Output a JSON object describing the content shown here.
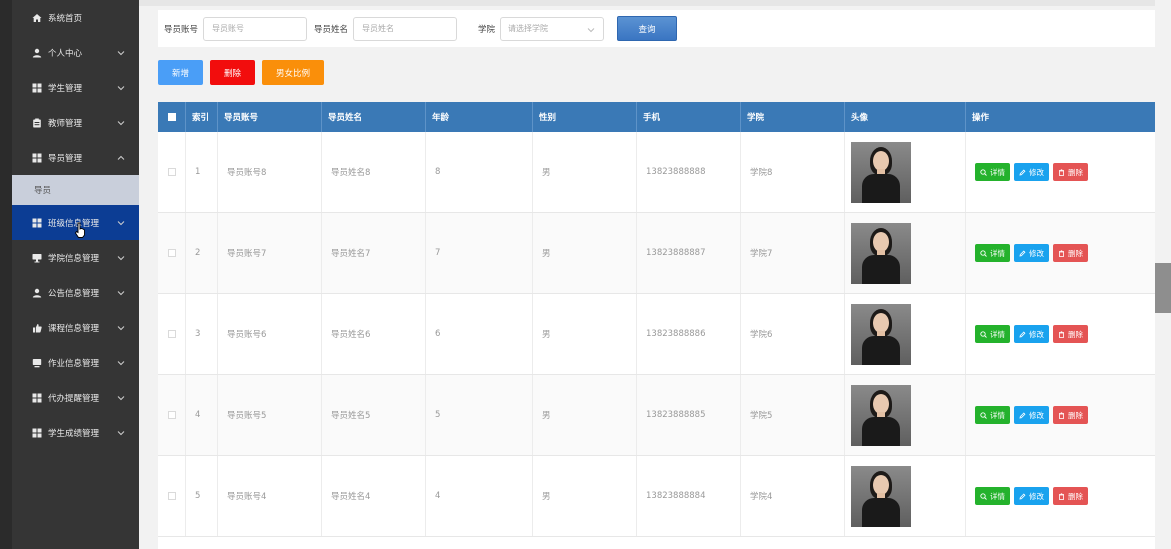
{
  "sidebar": {
    "items": [
      {
        "label": "系统首页",
        "icon": "home-icon",
        "arrow": false
      },
      {
        "label": "个人中心",
        "icon": "user-icon",
        "arrow": "down"
      },
      {
        "label": "学生管理",
        "icon": "grid-icon",
        "arrow": "down"
      },
      {
        "label": "教师管理",
        "icon": "clipboard-icon",
        "arrow": "down"
      },
      {
        "label": "导员管理",
        "icon": "grid-icon",
        "arrow": "up",
        "expanded": true,
        "submenu": [
          "导员"
        ]
      },
      {
        "label": "班级信息管理",
        "icon": "grid-icon",
        "arrow": "down",
        "active": true
      },
      {
        "label": "学院信息管理",
        "icon": "display-icon",
        "arrow": "down"
      },
      {
        "label": "公告信息管理",
        "icon": "user-icon",
        "arrow": "down"
      },
      {
        "label": "课程信息管理",
        "icon": "thumb-icon",
        "arrow": "down"
      },
      {
        "label": "作业信息管理",
        "icon": "monitor-icon",
        "arrow": "down"
      },
      {
        "label": "代办提醒管理",
        "icon": "grid-icon",
        "arrow": "down"
      },
      {
        "label": "学生成绩管理",
        "icon": "grid-icon",
        "arrow": "down"
      }
    ]
  },
  "search": {
    "account_label": "导员账号",
    "account_placeholder": "导员账号",
    "name_label": "导员姓名",
    "name_placeholder": "导员姓名",
    "college_label": "学院",
    "college_placeholder": "请选择学院",
    "query_label": "查询"
  },
  "actions": {
    "add_label": "新增",
    "delete_label": "删除",
    "ratio_label": "男女比例"
  },
  "table": {
    "headers": [
      "索引",
      "导员账号",
      "导员姓名",
      "年龄",
      "性别",
      "手机",
      "学院",
      "头像",
      "操作"
    ],
    "rows": [
      {
        "index": "1",
        "account": "导员账号8",
        "name": "导员姓名8",
        "age": "8",
        "gender": "男",
        "phone": "13823888888",
        "college": "学院8"
      },
      {
        "index": "2",
        "account": "导员账号7",
        "name": "导员姓名7",
        "age": "7",
        "gender": "男",
        "phone": "13823888887",
        "college": "学院7"
      },
      {
        "index": "3",
        "account": "导员账号6",
        "name": "导员姓名6",
        "age": "6",
        "gender": "男",
        "phone": "13823888886",
        "college": "学院6"
      },
      {
        "index": "4",
        "account": "导员账号5",
        "name": "导员姓名5",
        "age": "5",
        "gender": "男",
        "phone": "13823888885",
        "college": "学院5"
      },
      {
        "index": "5",
        "account": "导员账号4",
        "name": "导员姓名4",
        "age": "4",
        "gender": "男",
        "phone": "13823888884",
        "college": "学院4"
      }
    ],
    "op_detail": "详情",
    "op_edit": "修改",
    "op_delete": "删除"
  },
  "colors": {
    "sidebar_bg": "#353535",
    "sidebar_active": "#0c3d94",
    "header_bg": "#3a79b6",
    "add": "#4a9ef7",
    "delete": "#f20d0d",
    "ratio": "#fa8f0a",
    "detail": "#24b22c",
    "edit": "#19a2ee",
    "remove": "#e45454"
  }
}
